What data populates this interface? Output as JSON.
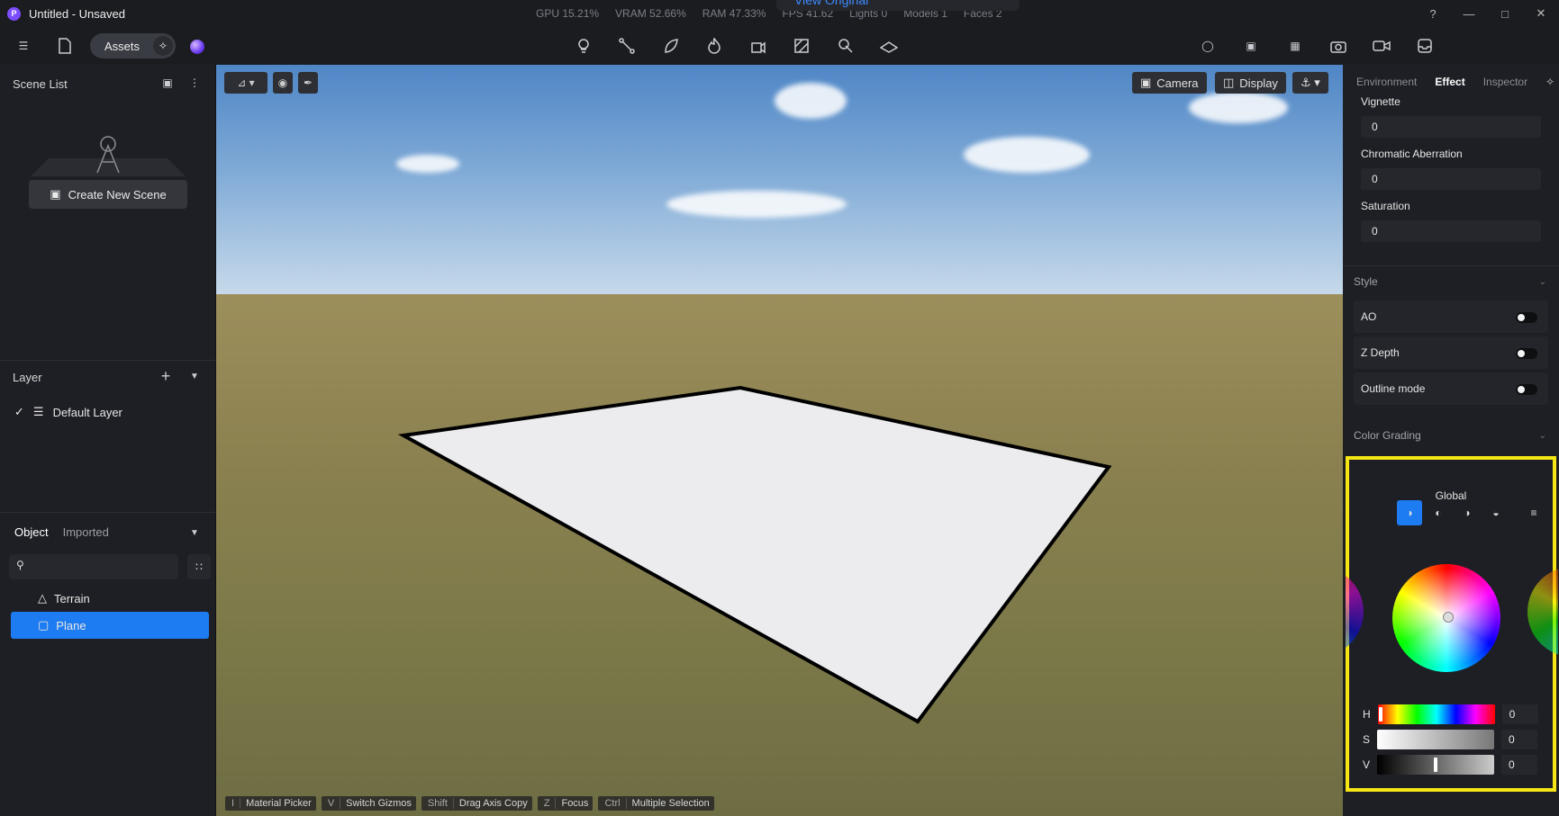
{
  "window": {
    "title": "Untitled - Unsaved",
    "app_logo": "P",
    "stats": [
      "GPU 15.21%",
      "VRAM 52.66%",
      "RAM 47.33%",
      "FPS 41.62",
      "Lights 0",
      "Models 1",
      "Faces 2"
    ],
    "overlay_label": "View Original"
  },
  "toolbar": {
    "assets_label": "Assets"
  },
  "left": {
    "scene_list_title": "Scene List",
    "create_scene_label": "Create New Scene",
    "layer_title": "Layer",
    "default_layer": "Default Layer",
    "tab_object": "Object",
    "tab_imported": "Imported",
    "search_placeholder": "",
    "objects": [
      "Terrain",
      "Plane"
    ]
  },
  "viewport": {
    "camera_label": "Camera",
    "display_label": "Display",
    "hints": [
      {
        "key": "I",
        "label": "Material Picker"
      },
      {
        "key": "V",
        "label": "Switch Gizmos"
      },
      {
        "key": "Shift",
        "label": "Drag Axis Copy"
      },
      {
        "key": "Z",
        "label": "Focus"
      },
      {
        "key": "Ctrl",
        "label": "Multiple Selection"
      }
    ]
  },
  "right": {
    "tabs": [
      "Environment",
      "Effect",
      "Inspector"
    ],
    "active_tab": "Effect",
    "props": [
      {
        "label": "Vignette",
        "value": "0"
      },
      {
        "label": "Chromatic Aberration",
        "value": "0"
      },
      {
        "label": "Saturation",
        "value": "0"
      }
    ],
    "style_title": "Style",
    "toggles": [
      "AO",
      "Z Depth",
      "Outline mode"
    ],
    "color_grading_title": "Color Grading",
    "global_label": "Global",
    "sliders": [
      {
        "label": "H",
        "value": "0"
      },
      {
        "label": "S",
        "value": "0"
      },
      {
        "label": "V",
        "value": "0"
      }
    ]
  },
  "colors": {
    "accent": "#1e7cf2",
    "highlight_box": "#f5e614"
  }
}
